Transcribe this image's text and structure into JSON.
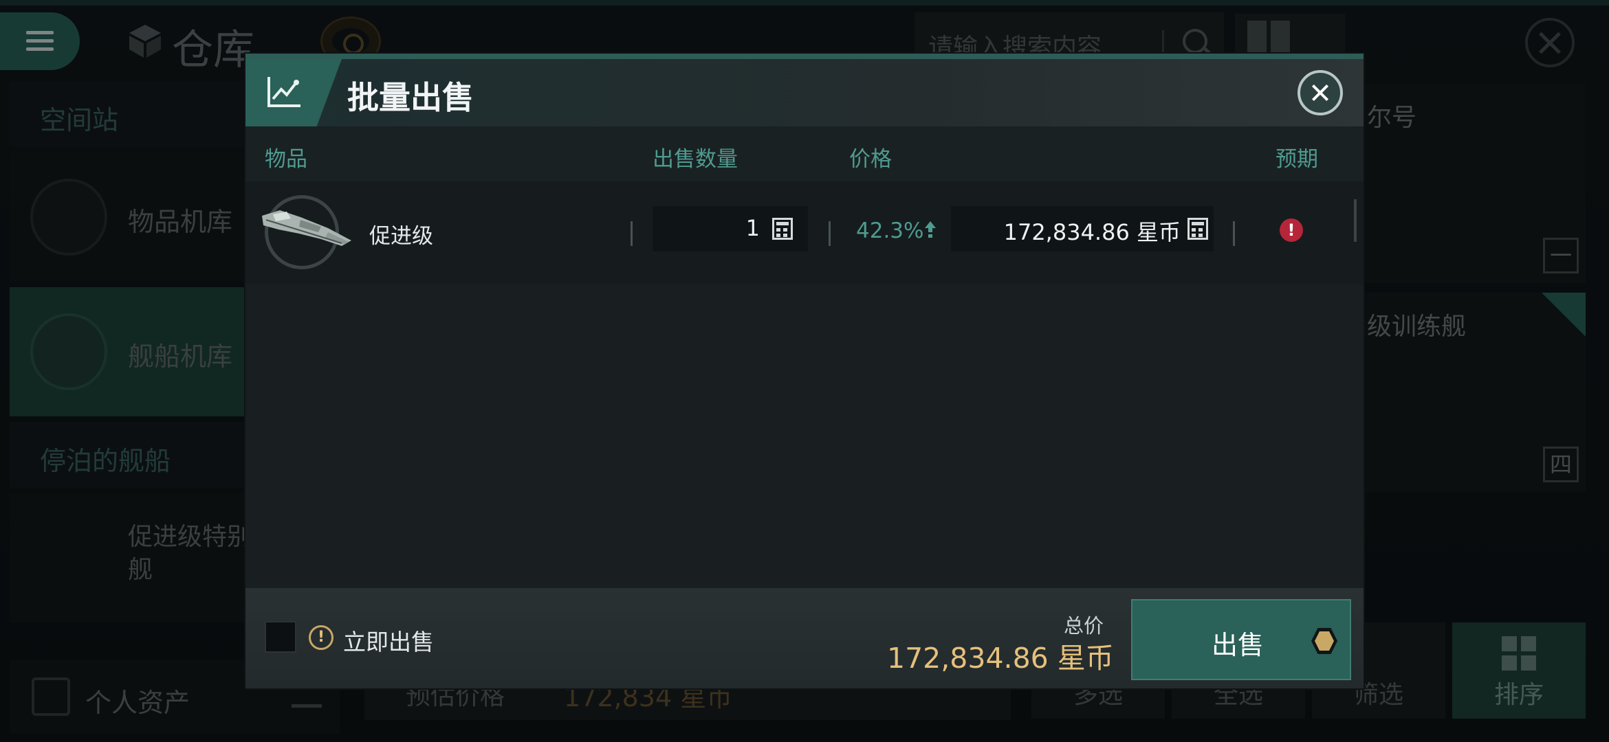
{
  "background": {
    "title": "仓库",
    "search_placeholder": "请输入搜索内容",
    "sidebar": {
      "section_station": "空间站",
      "items": [
        {
          "label": "物品机库"
        },
        {
          "label": "舰船机库"
        }
      ],
      "section_docked": "停泊的舰船",
      "docked_ship": "促进级特别舰",
      "assets": "个人资产"
    },
    "cards": [
      {
        "label": "尔号",
        "badge": "一"
      },
      {
        "label": "级训练舰",
        "badge": "四"
      }
    ],
    "estimate": {
      "label": "预估价格",
      "value": "172,834 星币"
    },
    "bottom_buttons": {
      "multi": "多选",
      "all": "全选",
      "filter": "筛选",
      "sort": "排序"
    }
  },
  "dialog": {
    "title": "批量出售",
    "columns": {
      "item": "物品",
      "quantity": "出售数量",
      "price": "价格",
      "expected": "预期"
    },
    "rows": [
      {
        "name": "促进级",
        "quantity": "1",
        "percent": "42.3%",
        "price": "172,834.86 星币"
      }
    ],
    "footer": {
      "instant_sell": "立即出售",
      "total_label": "总价",
      "total_value": "172,834.86 星币",
      "sell_button": "出售"
    }
  },
  "colors": {
    "accent": "#2a6158",
    "teal_text": "#4f9b90",
    "gold": "#e5c07c",
    "warning_red": "#b6263a"
  }
}
